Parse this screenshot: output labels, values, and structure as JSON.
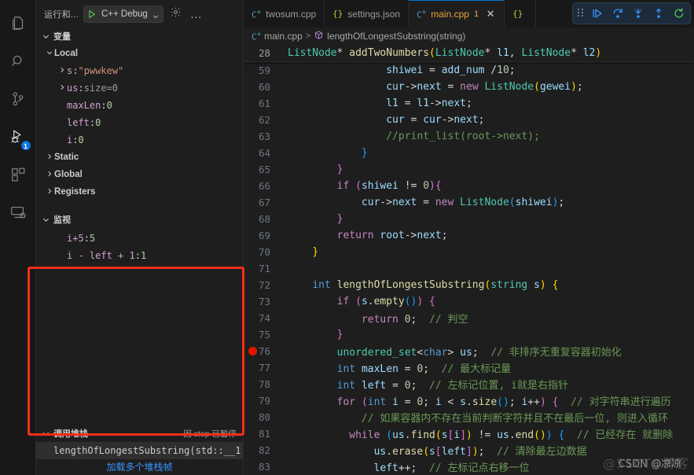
{
  "activity_bar": {
    "items": [
      {
        "name": "explorer",
        "icon": "files-icon",
        "active": false
      },
      {
        "name": "search",
        "icon": "search-icon",
        "active": false
      },
      {
        "name": "source-control",
        "icon": "source-control-icon",
        "active": false
      },
      {
        "name": "run-and-debug",
        "icon": "run-debug-icon",
        "active": true,
        "badge": "1"
      },
      {
        "name": "extensions",
        "icon": "extensions-icon",
        "active": false
      },
      {
        "name": "remote-explorer",
        "icon": "remote-explorer-icon",
        "active": false
      }
    ]
  },
  "sidebar": {
    "title": "运行和...",
    "debug_config": "C++ Debug",
    "settings_tooltip": "gear-icon",
    "more_tooltip": "...",
    "variables_pane": {
      "label": "变量",
      "scopes": [
        {
          "label": "Local",
          "expanded": true,
          "vars": [
            {
              "expandable": true,
              "name": "s",
              "sep": ": ",
              "value": "\"pwwkew\"",
              "vtype": "string"
            },
            {
              "expandable": true,
              "name": "us",
              "sep": ": ",
              "value": "size=0",
              "vtype": "dim"
            },
            {
              "expandable": false,
              "name": "maxLen",
              "sep": ": ",
              "value": "0",
              "vtype": "num"
            },
            {
              "expandable": false,
              "name": "left",
              "sep": ": ",
              "value": "0",
              "vtype": "num"
            },
            {
              "expandable": false,
              "name": "i",
              "sep": ": ",
              "value": "0",
              "vtype": "num"
            }
          ]
        },
        {
          "label": "Static",
          "expanded": false,
          "vars": []
        },
        {
          "label": "Global",
          "expanded": false,
          "vars": []
        },
        {
          "label": "Registers",
          "expanded": false,
          "vars": []
        }
      ]
    },
    "watch_pane": {
      "label": "监视",
      "items": [
        {
          "expr": "i+5",
          "sep": ": ",
          "value": "5"
        },
        {
          "expr": "i - left + 1",
          "sep": ": ",
          "value": "1"
        }
      ]
    },
    "callstack_pane": {
      "label": "调用堆栈",
      "status": "因 step 已暂停",
      "frames": [
        "lengthOfLongestSubstring(std::__1:"
      ],
      "load_more": "加载多个堆栈帧"
    },
    "highlight_color": "#ff2d16"
  },
  "editor": {
    "tabs": [
      {
        "label": "twosum.cpp",
        "icon": "cpp-file-icon",
        "active": false,
        "badge": "",
        "closable": false
      },
      {
        "label": "settings.json",
        "icon": "json-file-icon",
        "active": false,
        "badge": "",
        "closable": false
      },
      {
        "label": "main.cpp",
        "icon": "cpp-file-icon",
        "active": true,
        "badge": "1",
        "closable": true
      },
      {
        "label": "",
        "icon": "json-file-icon",
        "active": false,
        "badge": "",
        "closable": false
      }
    ],
    "debug_toolbar": [
      {
        "name": "drag-handle-icon",
        "glyph": "grip"
      },
      {
        "name": "continue-icon",
        "glyph": "continue"
      },
      {
        "name": "step-over-icon",
        "glyph": "step-over"
      },
      {
        "name": "step-into-icon",
        "glyph": "step-into"
      },
      {
        "name": "step-out-icon",
        "glyph": "step-out"
      },
      {
        "name": "restart-icon",
        "glyph": "restart"
      }
    ],
    "breadcrumb": {
      "file": "main.cpp",
      "separator": ">",
      "symbol": "lengthOfLongestSubstring(string)"
    },
    "sticky_line": {
      "number": "28",
      "text": "ListNode* addTwoNumbers(ListNode* l1, ListNode* l2)"
    },
    "breakpoint_line": "76",
    "lines": [
      {
        "n": "59",
        "indent": 4
      },
      {
        "n": "60",
        "indent": 4
      },
      {
        "n": "61",
        "indent": 4
      },
      {
        "n": "62",
        "indent": 4
      },
      {
        "n": "63",
        "indent": 4
      },
      {
        "n": "64",
        "indent": 3
      },
      {
        "n": "65",
        "indent": 2
      },
      {
        "n": "66",
        "indent": 2
      },
      {
        "n": "67",
        "indent": 3
      },
      {
        "n": "68",
        "indent": 2
      },
      {
        "n": "69",
        "indent": 2
      },
      {
        "n": "70",
        "indent": 1
      },
      {
        "n": "71",
        "indent": 0
      },
      {
        "n": "72",
        "indent": 0
      },
      {
        "n": "73",
        "indent": 1
      },
      {
        "n": "74",
        "indent": 2
      },
      {
        "n": "75",
        "indent": 1
      },
      {
        "n": "76",
        "indent": 1
      },
      {
        "n": "77",
        "indent": 1
      },
      {
        "n": "78",
        "indent": 1
      },
      {
        "n": "79",
        "indent": 1
      },
      {
        "n": "80",
        "indent": 2
      },
      {
        "n": "81",
        "indent": 2
      },
      {
        "n": "82",
        "indent": 3
      },
      {
        "n": "83",
        "indent": 3
      }
    ],
    "source_text": {
      "59": "                shiwei = add_num /10;",
      "60": "                cur->next = new ListNode(gewei);",
      "61": "                l1 = l1->next;",
      "62": "                cur = cur->next;",
      "63": "                //print_list(root->next);",
      "64": "            }",
      "65": "        }",
      "66": "        if (shiwei != 0){",
      "67": "            cur->next = new ListNode(shiwei);",
      "68": "        }",
      "69": "        return root->next;",
      "70": "    }",
      "71": "",
      "72": "    int lengthOfLongestSubstring(string s) {",
      "73": "        if (s.empty()) {",
      "74": "            return 0;  // 判空",
      "75": "        }",
      "76": "        unordered_set<char> us;  // 非排序无重复容器初始化",
      "77": "        int maxLen = 0;  // 最大标记量",
      "78": "        int left = 0;  // 左标记位置, i就是右指针",
      "79": "        for (int i = 0; i < s.size(); i++) {  // 对字符串进行遍历",
      "80": "            // 如果容器内不存在当前判断字符并且不在最后一位, 则进入循环",
      "81": "            while (us.find(s[i]) != us.end()) {  // 已经存在 就删除",
      "82": "                us.erase(s[left]);  // 清除最左边数据",
      "83": "                left++;  // 左标记点右移一位"
    }
  },
  "watermarks": {
    "primary": "@51CTO博客",
    "secondary": "CSDN @凉凉"
  }
}
